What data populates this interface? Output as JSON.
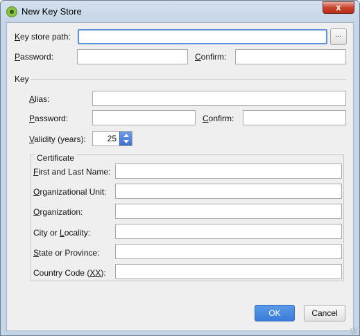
{
  "window": {
    "title": "New Key Store",
    "close_label": "x"
  },
  "keystore": {
    "path_label": "Key store path:",
    "path_underline": "K",
    "path_rest": "ey store path:",
    "path_value": "",
    "browse_label": "...",
    "password_underline": "P",
    "password_rest": "assword:",
    "confirm_underline": "C",
    "confirm_rest": "onfirm:"
  },
  "key": {
    "section_label": "Key",
    "alias_underline": "A",
    "alias_rest": "lias:",
    "password_pre": "",
    "password_underline": "P",
    "password_rest": "assword:",
    "confirm_underline": "C",
    "confirm_rest": "onfirm:",
    "validity_underline": "V",
    "validity_rest": "alidity (years):",
    "validity_value": "25"
  },
  "certificate": {
    "legend": "Certificate",
    "fields": [
      {
        "pre": "",
        "u": "F",
        "rest": "irst and Last Name:"
      },
      {
        "pre": "",
        "u": "O",
        "rest": "rganizational Unit:"
      },
      {
        "pre": "",
        "u": "O",
        "rest": "rganization:"
      },
      {
        "pre": "City or ",
        "u": "L",
        "rest": "ocality:"
      },
      {
        "pre": "",
        "u": "S",
        "rest": "tate or Province:"
      },
      {
        "pre": "Country Code (",
        "u": "XX",
        "rest": "):"
      }
    ]
  },
  "buttons": {
    "ok": "OK",
    "cancel": "Cancel"
  }
}
